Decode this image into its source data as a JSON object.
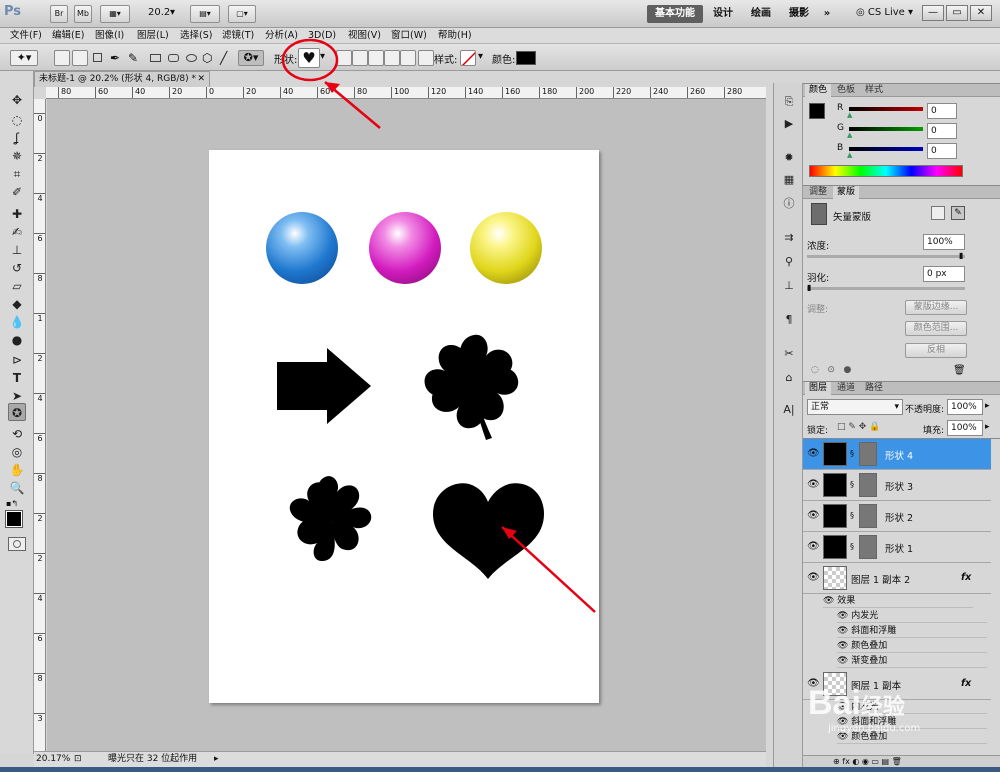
{
  "app": {
    "logo": "Ps",
    "zoom_level": "20.2",
    "bridge_label": "Br",
    "minibridge_label": "Mb",
    "workspaces": [
      "基本功能",
      "设计",
      "绘画",
      "摄影"
    ],
    "more_label": "»",
    "cslive_label": "CS Live",
    "win_ctrls": [
      "—",
      "▭",
      "✕"
    ]
  },
  "menu": [
    "文件(F)",
    "编辑(E)",
    "图像(I)",
    "图层(L)",
    "选择(S)",
    "滤镜(T)",
    "分析(A)",
    "3D(D)",
    "视图(V)",
    "窗口(W)",
    "帮助(H)"
  ],
  "options": {
    "shape_label": "形状:",
    "style_label": "样式:",
    "color_label": "颜色:",
    "color_value": "#000000"
  },
  "document": {
    "tab_title": "未标题-1 @ 20.2% (形状 4, RGB/8) *",
    "close": "✕",
    "h_ticks": [
      "80",
      "60",
      "40",
      "20",
      "0",
      "20",
      "40",
      "60",
      "80",
      "100",
      "120",
      "140",
      "160",
      "180",
      "200",
      "220",
      "240",
      "260",
      "280"
    ],
    "v_ticks": [
      "0",
      "2",
      "4",
      "6",
      "8",
      "1",
      "2",
      "4",
      "6",
      "8",
      "2",
      "2",
      "4",
      "6",
      "8",
      "3"
    ]
  },
  "status": {
    "zoom": "20.17%",
    "info": "曝光只在 32 位起作用"
  },
  "color_panel": {
    "tabs": [
      "颜色",
      "色板",
      "样式"
    ],
    "channels": [
      {
        "name": "R",
        "value": "0",
        "color": "#c00000"
      },
      {
        "name": "G",
        "value": "0",
        "color": "#00a000"
      },
      {
        "name": "B",
        "value": "0",
        "color": "#0000c0"
      }
    ]
  },
  "mask_panel": {
    "tabs": [
      "调整",
      "蒙版"
    ],
    "title": "矢量蒙版",
    "density_label": "浓度:",
    "density_value": "100%",
    "feather_label": "羽化:",
    "feather_value": "0 px",
    "refine_label": "调整:",
    "buttons": [
      "蒙版边缘...",
      "颜色范围...",
      "反相"
    ]
  },
  "layers_panel": {
    "tabs": [
      "图层",
      "通道",
      "路径"
    ],
    "blend_mode": "正常",
    "opacity_label": "不透明度:",
    "opacity_value": "100%",
    "lock_label": "锁定:",
    "fill_label": "填充:",
    "fill_value": "100%",
    "layers": [
      {
        "name": "形状 4",
        "selected": true
      },
      {
        "name": "形状 3",
        "selected": false
      },
      {
        "name": "形状 2",
        "selected": false
      },
      {
        "name": "形状 1",
        "selected": false
      }
    ],
    "copy2": {
      "name": "图层 1 副本 2",
      "fx": "fx",
      "effects_label": "效果",
      "effects": [
        "内发光",
        "斜面和浮雕",
        "颜色叠加",
        "渐变叠加"
      ]
    },
    "copy1": {
      "name": "图层 1 副本",
      "fx": "fx",
      "effects": [
        "内发光",
        "斜面和浮雕",
        "颜色叠加"
      ]
    }
  },
  "watermark": {
    "brand": "Bai",
    "brand2": "经验",
    "url": "jingyan.baidu.com"
  }
}
